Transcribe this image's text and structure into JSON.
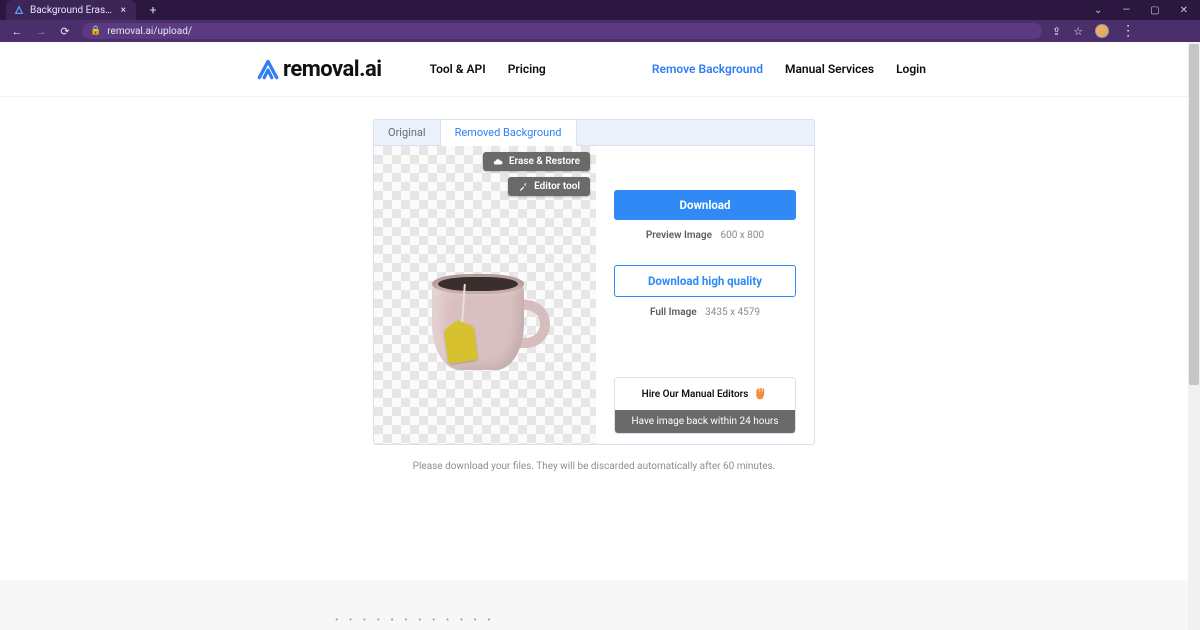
{
  "browser": {
    "tab_title": "Background Eraser: Upload Your",
    "url": "removal.ai/upload/"
  },
  "header": {
    "brand": "removal.ai",
    "nav_left": {
      "tool_api": "Tool & API",
      "pricing": "Pricing"
    },
    "nav_right": {
      "remove_bg": "Remove Background",
      "manual": "Manual Services",
      "login": "Login"
    }
  },
  "panel": {
    "tabs": {
      "original": "Original",
      "removed": "Removed Background"
    },
    "tools": {
      "erase_restore": "Erase & Restore",
      "editor_tool": "Editor tool"
    },
    "download": {
      "button": "Download",
      "preview_label": "Preview Image",
      "preview_dims": "600 x 800"
    },
    "download_hq": {
      "button": "Download high quality",
      "full_label": "Full Image",
      "full_dims": "3435 x 4579"
    },
    "hire": {
      "headline": "Hire Our Manual Editors",
      "sub": "Have image back within 24 hours"
    }
  },
  "notice": "Please download your files. They will be discarded automatically after 60 minutes."
}
